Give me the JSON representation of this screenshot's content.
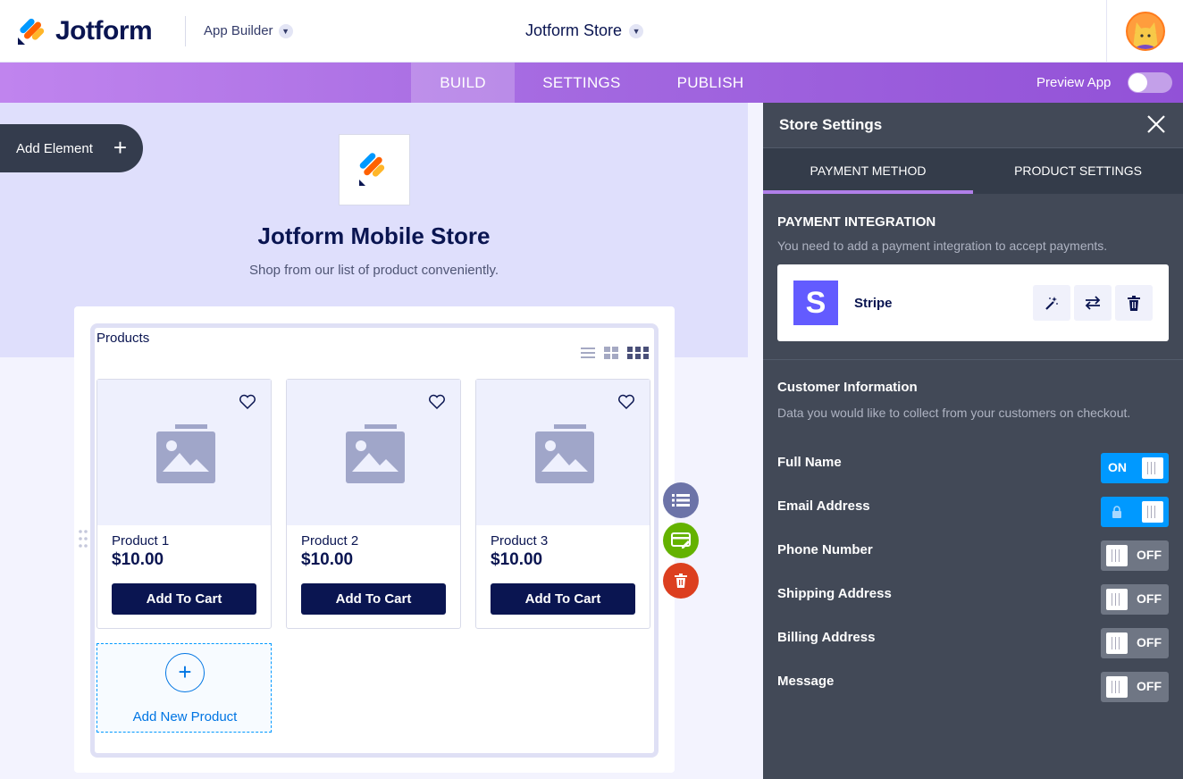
{
  "header": {
    "brand": "Jotform",
    "app_builder": "App Builder",
    "store_title": "Jotform Store"
  },
  "nav": {
    "tabs": [
      "BUILD",
      "SETTINGS",
      "PUBLISH"
    ],
    "active": "BUILD",
    "preview_label": "Preview App",
    "preview_enabled": false
  },
  "canvas": {
    "add_element": "Add Element",
    "store_name": "Jotform Mobile Store",
    "store_subtitle": "Shop from our list of product conveniently.",
    "products_label": "Products",
    "products": [
      {
        "name": "Product 1",
        "price": "$10.00",
        "button": "Add To Cart"
      },
      {
        "name": "Product 2",
        "price": "$10.00",
        "button": "Add To Cart"
      },
      {
        "name": "Product 3",
        "price": "$10.00",
        "button": "Add To Cart"
      }
    ],
    "add_product": "Add New Product"
  },
  "panel": {
    "title": "Store Settings",
    "tabs": [
      "PAYMENT METHOD",
      "PRODUCT SETTINGS"
    ],
    "active_tab": "PAYMENT METHOD",
    "payment_integration": {
      "title": "PAYMENT INTEGRATION",
      "subtitle": "You need to add a payment integration to accept payments.",
      "provider": "Stripe",
      "provider_letter": "S"
    },
    "customer_info": {
      "title": "Customer Information",
      "subtitle": "Data you would like to collect from your customers on checkout.",
      "fields": [
        {
          "label": "Full Name",
          "state": "ON"
        },
        {
          "label": "Email Address",
          "state": ""
        },
        {
          "label": "Phone Number",
          "state": "OFF"
        },
        {
          "label": "Shipping Address",
          "state": "OFF"
        },
        {
          "label": "Billing Address",
          "state": "OFF"
        },
        {
          "label": "Message",
          "state": "OFF"
        }
      ]
    }
  },
  "colors": {
    "brand_navy": "#0a1551",
    "nav_purple": "#a368e0",
    "toggle_on": "#0099ff",
    "panel_bg": "#424957",
    "stripe": "#635bff"
  }
}
